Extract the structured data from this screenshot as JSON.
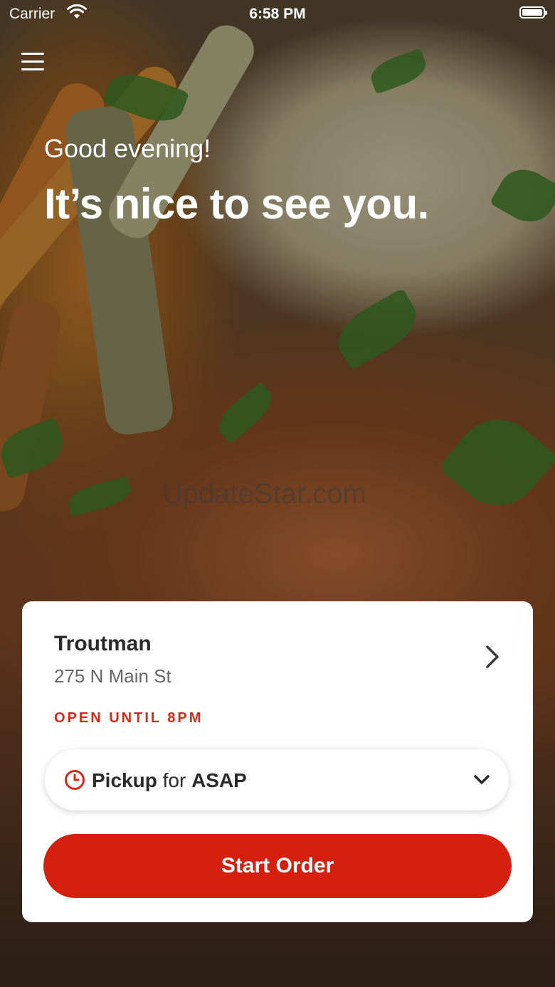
{
  "status_bar": {
    "carrier": "Carrier",
    "time": "6:58 PM"
  },
  "hero": {
    "greeting": "Good evening!",
    "headline": "It’s nice to see you.",
    "watermark": "UpdateStar.com"
  },
  "location_card": {
    "store_name": "Troutman",
    "address": "275 N Main St",
    "hours_status": "OPEN UNTIL 8PM",
    "order_mode": {
      "mode": "Pickup",
      "connector": "for",
      "time": "ASAP"
    },
    "start_order_label": "Start Order"
  },
  "colors": {
    "accent": "#d5200f",
    "hours_text": "#d42a18",
    "card_bg": "#ffffff"
  },
  "icons": [
    "hamburger-menu-icon",
    "wifi-icon",
    "battery-icon",
    "chevron-right-icon",
    "clock-icon",
    "chevron-down-icon"
  ]
}
